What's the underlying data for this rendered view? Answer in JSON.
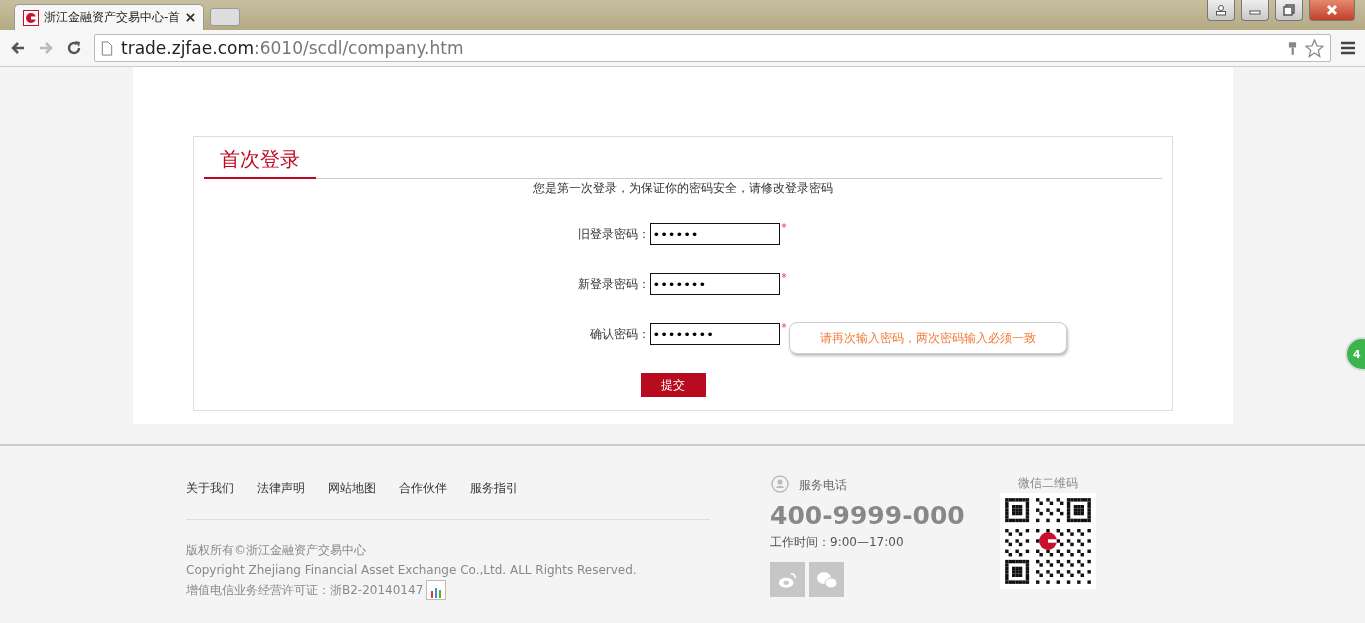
{
  "browser": {
    "tab_title": "浙江金融资产交易中心-首",
    "url_host": "trade.zjfae.com",
    "url_path": ":6010/scdl/company.htm"
  },
  "form": {
    "title": "首次登录",
    "notice": "您是第一次登录，为保证你的密码安全，请修改登录密码",
    "fields": [
      {
        "label": "旧登录密码：",
        "value": "••••••",
        "required_mark": "*"
      },
      {
        "label": "新登录密码：",
        "value": "•••••••",
        "required_mark": "*"
      },
      {
        "label": "确认密码：",
        "value": "••••••••",
        "required_mark": "*",
        "tooltip": "请再次输入密码，两次密码输入必须一致"
      }
    ],
    "submit": "提交"
  },
  "floating_badge": "4",
  "footer": {
    "links": [
      "关于我们",
      "法律声明",
      "网站地图",
      "合作伙伴",
      "服务指引"
    ],
    "copyright": "版权所有©浙江金融资产交易中心",
    "copyright_en": "Copyright Zhejiang Financial Asset Exchange Co.,Ltd. ALL Rights Reserved.",
    "license": "增值电信业务经营许可证：浙B2-20140147",
    "service_label": "服务电话",
    "phone": "400-9999-000",
    "hours": "工作时间：9:00—17:00",
    "qr_label": "微信二维码"
  }
}
